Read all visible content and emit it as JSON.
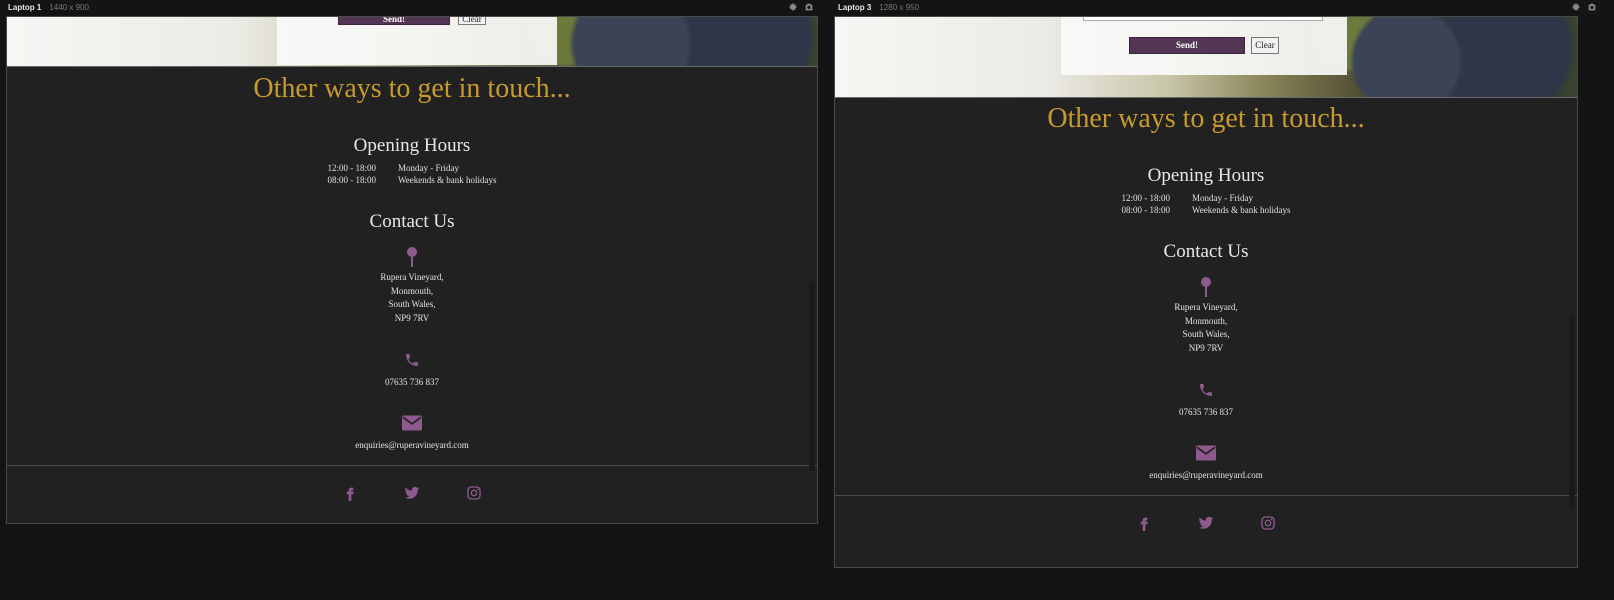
{
  "devices": [
    {
      "name": "Laptop 1",
      "dims": "1440 x 900"
    },
    {
      "name": "Laptop 3",
      "dims": "1280 x 950"
    }
  ],
  "form": {
    "send_label": "Send!",
    "clear_label": "Clear"
  },
  "page": {
    "heading": "Other ways to get in touch...",
    "hours": {
      "title": "Opening Hours",
      "rows": [
        {
          "time": "12:00 - 18:00",
          "days": "Monday - Friday"
        },
        {
          "time": "08:00 - 18:00",
          "days": "Weekends & bank holidays"
        }
      ]
    },
    "contact": {
      "title": "Contact Us",
      "address": [
        "Rupera Vineyard,",
        "Monmouth,",
        "South Wales,",
        "NP9 7RV"
      ],
      "phone": "07635 736 837",
      "email": "enquiries@ruperavineyard.com"
    },
    "socials": [
      "facebook-icon",
      "twitter-icon",
      "instagram-icon"
    ]
  },
  "colors": {
    "gold": "#c79a2e",
    "purple": "#8e5a8e",
    "background": "#212121",
    "button": "#533653"
  }
}
